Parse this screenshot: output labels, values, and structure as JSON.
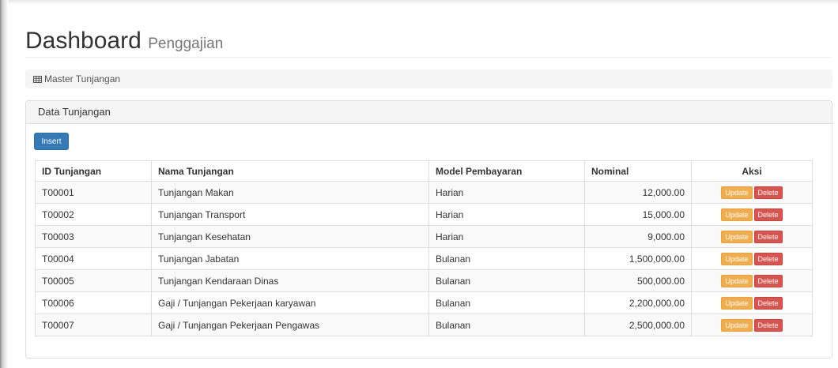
{
  "header": {
    "title": "Dashboard",
    "subtitle": "Penggajian"
  },
  "breadcrumb": {
    "icon": "table-icon",
    "label": "Master Tunjangan"
  },
  "panel": {
    "title": "Data Tunjangan",
    "insert_label": "Insert",
    "columns": [
      "ID Tunjangan",
      "Nama Tunjangan",
      "Model Pembayaran",
      "Nominal",
      "Aksi"
    ],
    "update_label": "Update",
    "delete_label": "Delete",
    "rows": [
      {
        "id": "T00001",
        "nama": "Tunjangan Makan",
        "model": "Harian",
        "nominal": "12,000.00"
      },
      {
        "id": "T00002",
        "nama": "Tunjangan Transport",
        "model": "Harian",
        "nominal": "15,000.00"
      },
      {
        "id": "T00003",
        "nama": "Tunjangan Kesehatan",
        "model": "Harian",
        "nominal": "9,000.00"
      },
      {
        "id": "T00004",
        "nama": "Tunjangan Jabatan",
        "model": "Bulanan",
        "nominal": "1,500,000.00"
      },
      {
        "id": "T00005",
        "nama": "Tunjangan Kendaraan Dinas",
        "model": "Bulanan",
        "nominal": "500,000.00"
      },
      {
        "id": "T00006",
        "nama": "Gaji / Tunjangan Pekerjaan karyawan",
        "model": "Bulanan",
        "nominal": "2,200,000.00"
      },
      {
        "id": "T00007",
        "nama": "Gaji / Tunjangan Pekerjaan Pengawas",
        "model": "Bulanan",
        "nominal": "2,500,000.00"
      }
    ]
  },
  "colors": {
    "primary": "#337ab7",
    "warning": "#f0ad4e",
    "danger": "#d9534f",
    "panel_heading": "#f5f5f5",
    "border": "#dddddd"
  }
}
